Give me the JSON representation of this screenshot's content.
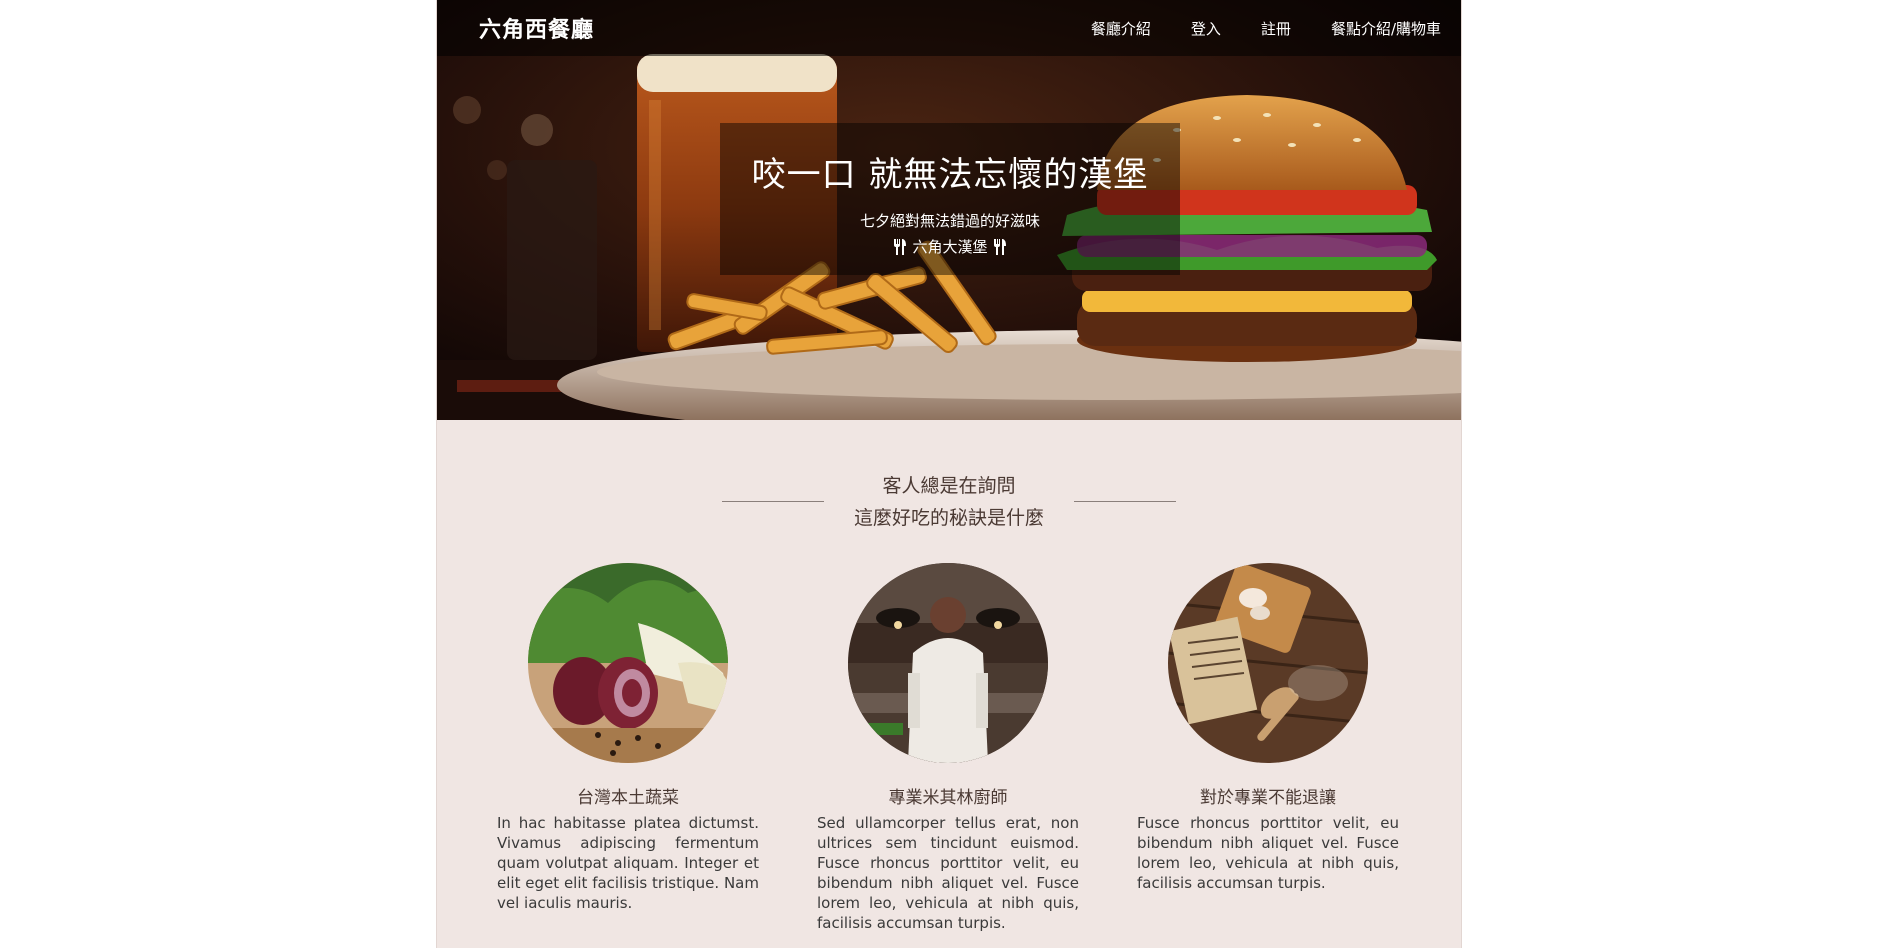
{
  "navbar": {
    "brand": "六角西餐廳",
    "links": [
      "餐廳介紹",
      "登入",
      "註冊",
      "餐點介紹/購物車"
    ]
  },
  "hero": {
    "title": "咬一口 就無法忘懷的漢堡",
    "subtitle": "七夕絕對無法錯過的好滋味",
    "tagline": "六角大漢堡"
  },
  "section": {
    "heading_line1": "客人總是在詢問",
    "heading_line2": "這麼好吃的秘訣是什麼"
  },
  "features": [
    {
      "title": "台灣本土蔬菜",
      "text": "In hac habitasse platea dictumst. Vivamus adipiscing fermentum quam volutpat aliquam. Integer et elit eget elit facilisis tristique. Nam vel iaculis mauris."
    },
    {
      "title": "專業米其林廚師",
      "text": "Sed ullamcorper tellus erat, non ultrices sem tincidunt euismod. Fusce rhoncus porttitor velit, eu bibendum nibh aliquet vel. Fusce lorem leo, vehicula at nibh quis, facilisis accumsan turpis."
    },
    {
      "title": "對於專業不能退讓",
      "text": "Fusce rhoncus porttitor velit, eu bibendum nibh aliquet vel. Fusce lorem leo, vehicula at nibh quis, facilisis accumsan turpis."
    }
  ],
  "icons": {
    "tagline_left": "utensils-icon",
    "tagline_right": "utensils-icon"
  },
  "colors": {
    "section_bg": "#f0e6e3",
    "heading_text": "#4b3a34",
    "nav_text": "#ffffff"
  }
}
